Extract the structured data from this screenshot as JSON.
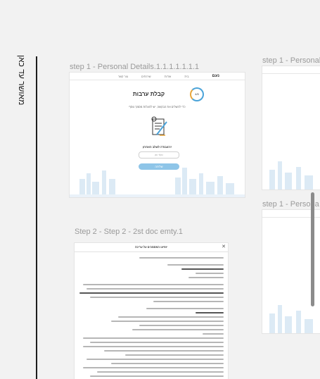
{
  "section": {
    "title": "מאושר עד כאן"
  },
  "frames": [
    {
      "label": "step 1 - Personal Details.1.1.1.1.1.1.1"
    },
    {
      "label": "Step 2 - Step 2 - 2st doc emty.1"
    },
    {
      "label": "step 1 - Personal"
    },
    {
      "label": "step 1 - Persona"
    }
  ],
  "screen1": {
    "logo": "נעם",
    "nav": [
      "בית",
      "אודות",
      "שירותים",
      "צור קשר"
    ],
    "title": "קבלת ערבות",
    "gauge": "4/5",
    "subtitle": "כדי להשלים את הבקשה, יש להעלות מסמך נוסף",
    "question": "העבודה לשלב האחרון?",
    "input_placeholder": "הקלד כאן",
    "button": "שליחה"
  },
  "screen2": {
    "doc_title": "יופיעו המסמכים על עריכה",
    "close": "✕"
  },
  "colors": {
    "canvas": "#f2f2f2",
    "accent": "#8ec5e8",
    "section_bar": "#1e1e1e"
  }
}
